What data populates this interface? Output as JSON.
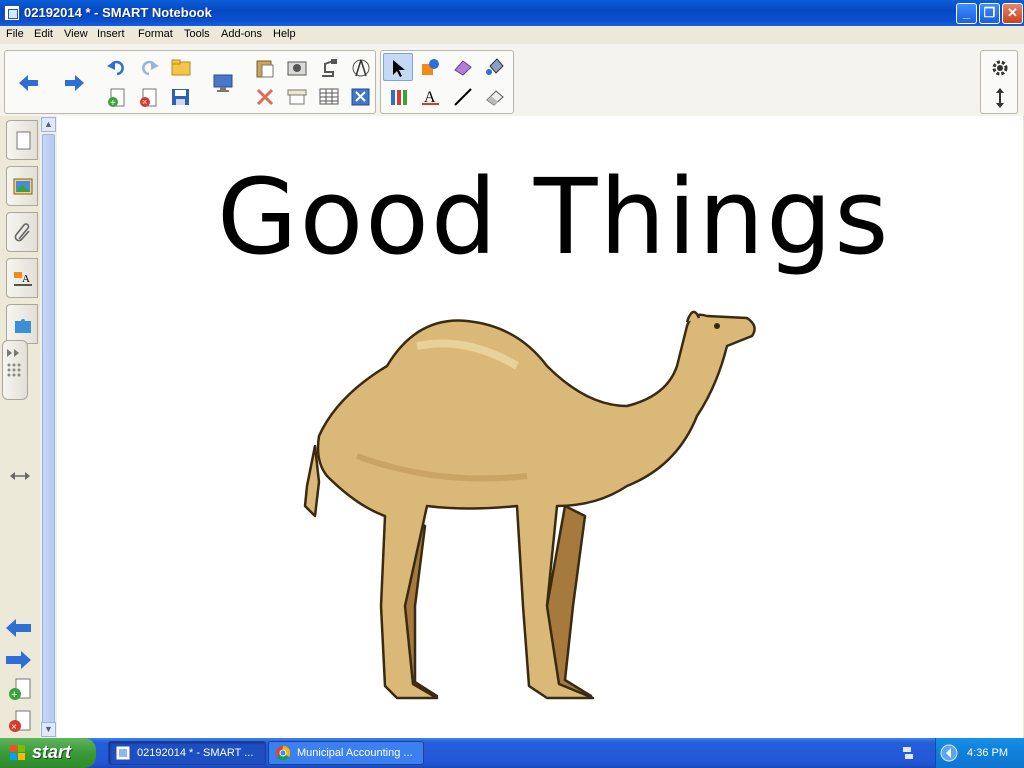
{
  "window": {
    "title": "02192014 * - SMART Notebook"
  },
  "menu": [
    "File",
    "Edit",
    "View",
    "Insert",
    "Format",
    "Tools",
    "Add-ons",
    "Help"
  ],
  "toolbar": {
    "icons": [
      "back-arrow-icon",
      "forward-arrow-icon",
      "undo-icon",
      "redo-icon",
      "open-folder-icon",
      "new-page-icon",
      "delete-page-icon",
      "save-icon",
      "display-screen-icon",
      "paste-icon",
      "screen-capture-icon",
      "delete-icon",
      "screen-shade-icon",
      "table-icon",
      "measurement-tools-icon",
      "document-camera-icon",
      "select-icon",
      "shapes-icon",
      "creative-pen-icon",
      "fill-icon",
      "pens-icon",
      "text-icon",
      "line-icon",
      "eraser-icon",
      "settings-gear-icon",
      "move-toolbar-icon"
    ]
  },
  "sidebar": {
    "tabs": [
      "page-sorter-icon",
      "gallery-icon",
      "attachments-icon",
      "properties-icon",
      "add-ons-icon"
    ]
  },
  "page": {
    "title": "Good Things"
  },
  "taskbar": {
    "start": "start",
    "tasks": [
      {
        "label": "02192014 * - SMART ..."
      },
      {
        "label": "Municipal Accounting ..."
      }
    ],
    "clock": "4:36 PM"
  },
  "colors": {
    "accent": "#245edb",
    "camel": "#d9b878",
    "camel_shadow": "#a57a3c"
  }
}
